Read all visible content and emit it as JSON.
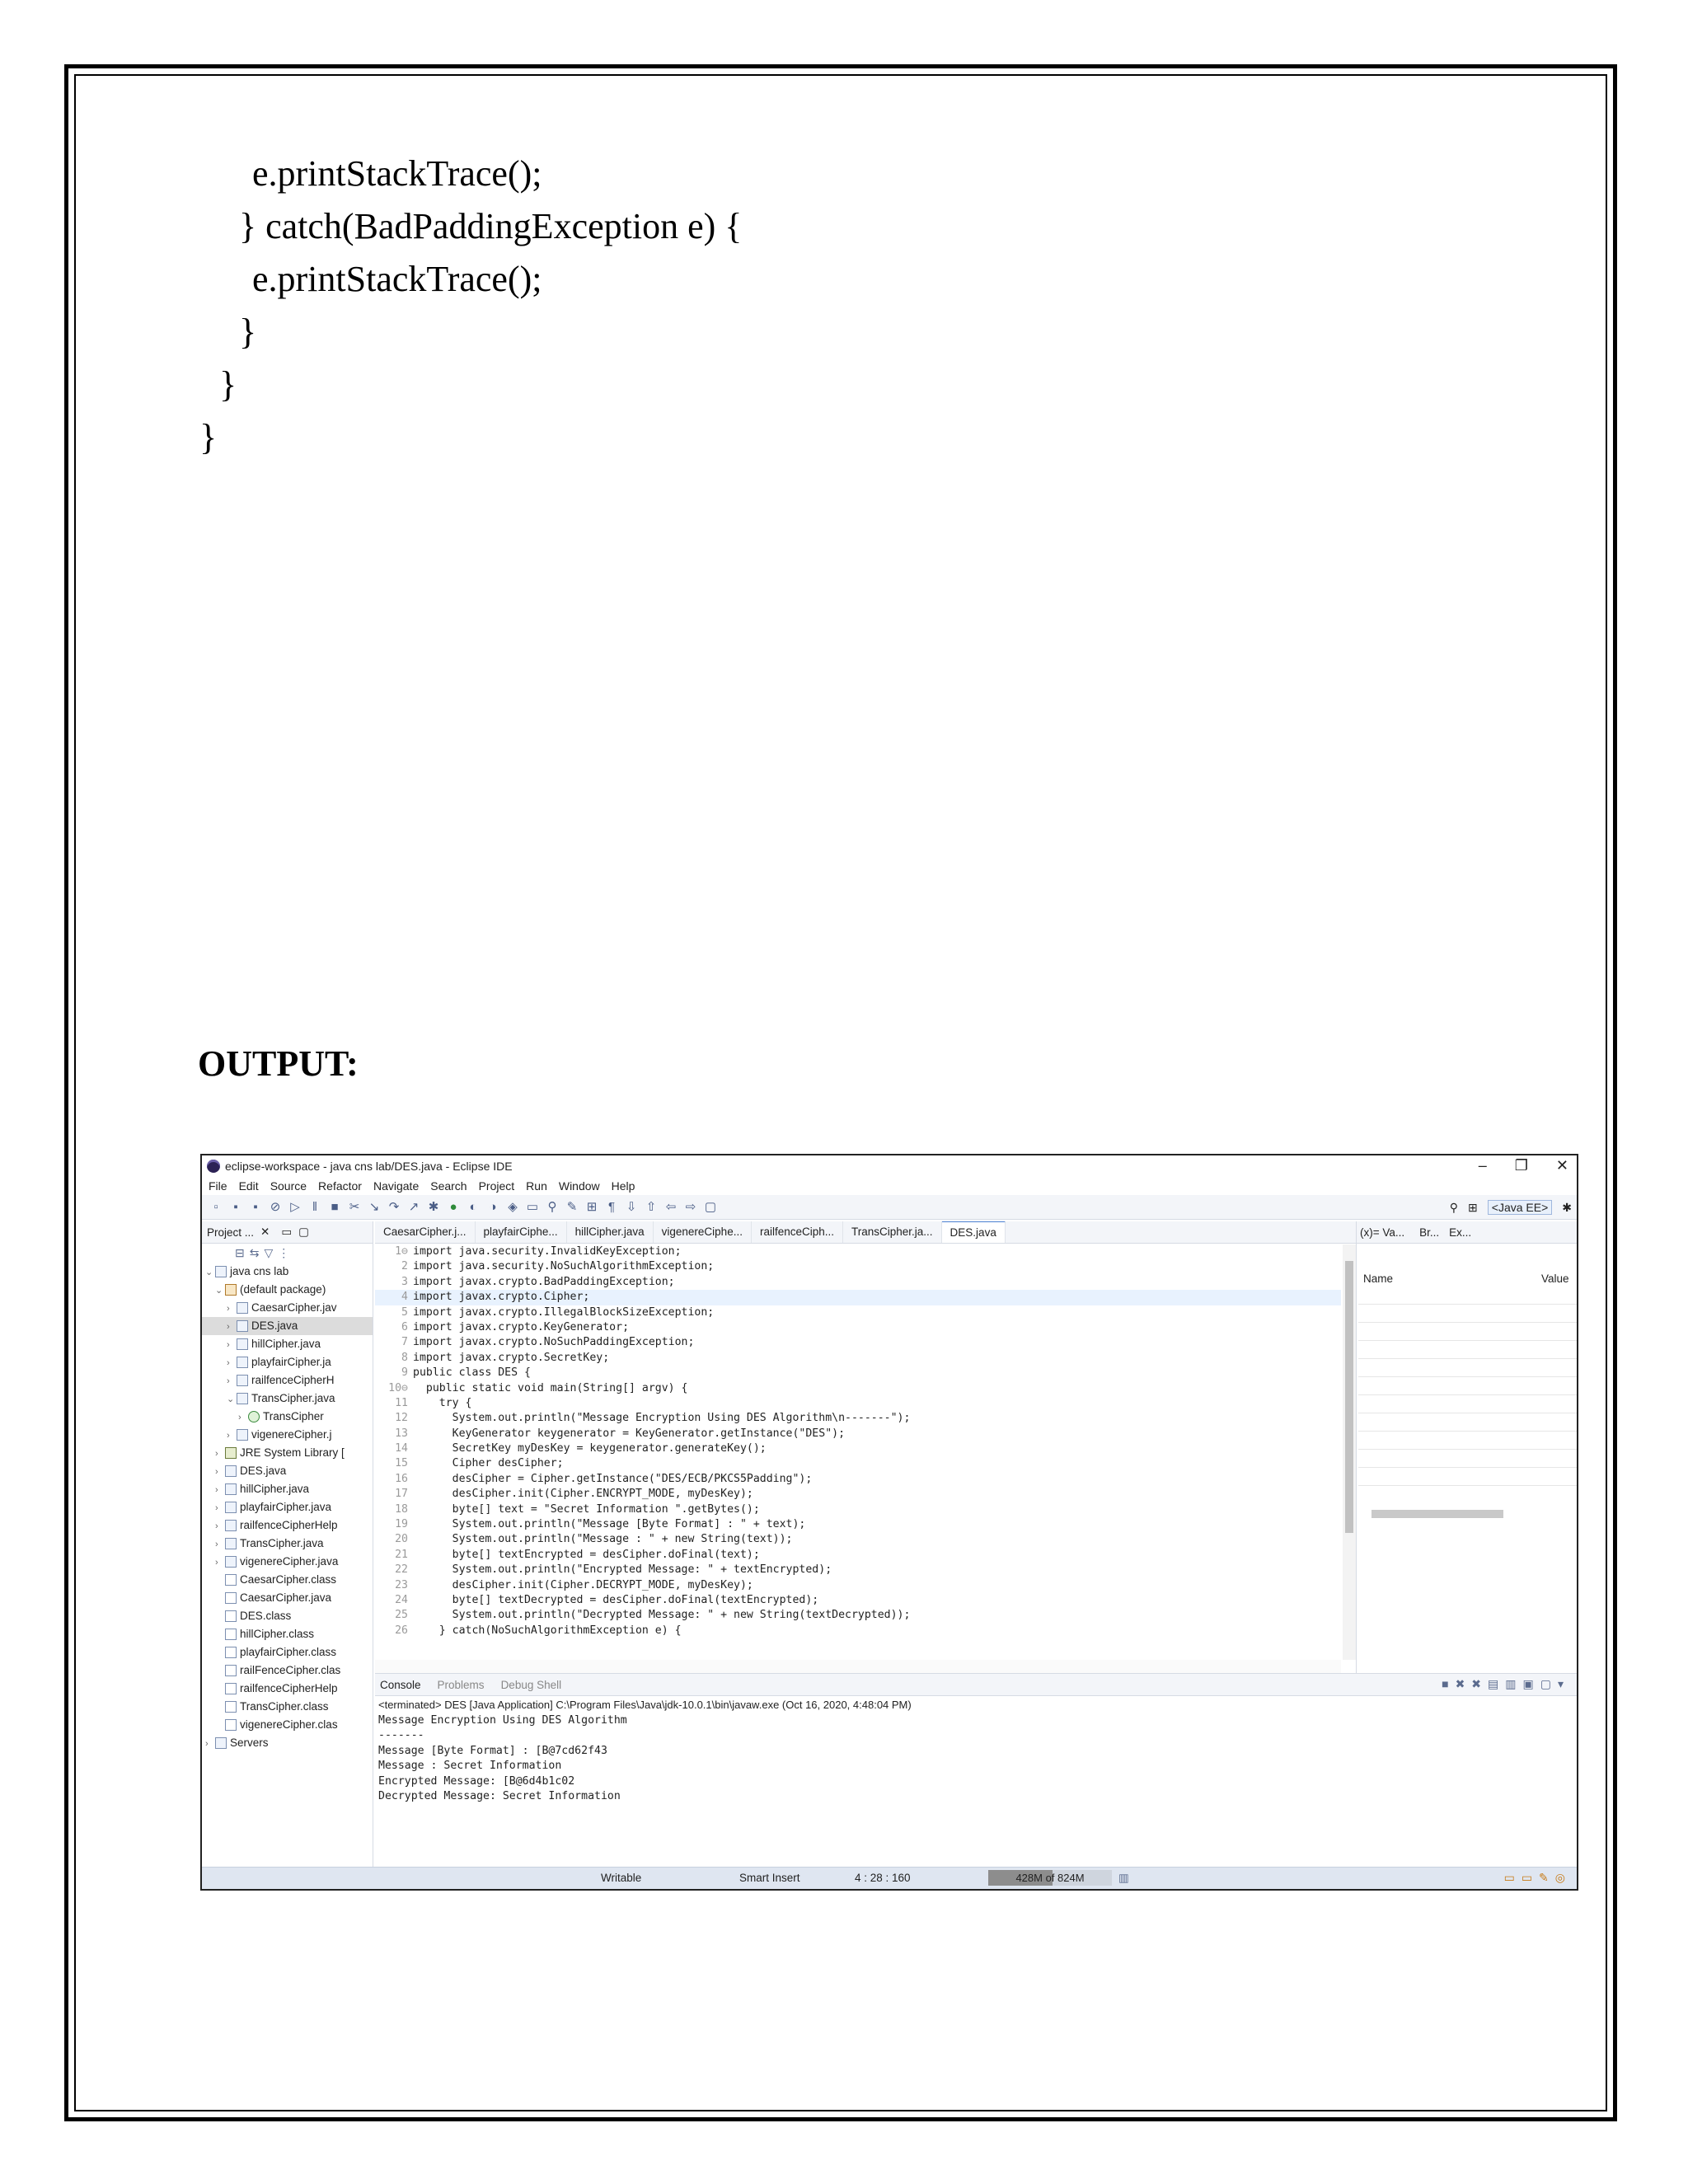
{
  "document": {
    "code_lines": [
      "e.printStackTrace();",
      "} catch(BadPaddingException e) {",
      "e.printStackTrace();",
      "}",
      "}",
      "}"
    ],
    "output_heading": "OUTPUT:"
  },
  "eclipse": {
    "window_title": "eclipse-workspace - java cns lab/DES.java - Eclipse IDE",
    "window_buttons": [
      "–",
      "❐",
      "✕"
    ],
    "menu": [
      "File",
      "Edit",
      "Source",
      "Refactor",
      "Navigate",
      "Search",
      "Project",
      "Run",
      "Window",
      "Help"
    ],
    "perspective": "<Java EE>",
    "explorer": {
      "title": "Project ...",
      "items": [
        "java cns lab",
        "(default package)",
        "CaesarCipher.jav",
        "DES.java",
        "hillCipher.java",
        "playfairCipher.ja",
        "railfenceCipherH",
        "TransCipher.java",
        "TransCipher",
        "vigenereCipher.j",
        "JRE System Library [",
        "DES.java",
        "hillCipher.java",
        "playfairCipher.java",
        "railfenceCipherHelp",
        "TransCipher.java",
        "vigenereCipher.java",
        "CaesarCipher.class",
        "CaesarCipher.java",
        "DES.class",
        "hillCipher.class",
        "playfairCipher.class",
        "railFenceCipher.clas",
        "railfenceCipherHelp",
        "TransCipher.class",
        "vigenereCipher.clas",
        "Servers"
      ]
    },
    "editor_tabs": [
      "CaesarCipher.j...",
      "playfairCiphe...",
      "hillCipher.java",
      "vigenereCiphe...",
      "railfenceCiph...",
      "TransCipher.ja...",
      "DES.java"
    ],
    "code": [
      {
        "n": "1⊖",
        "t": "import java.security.InvalidKeyException;"
      },
      {
        "n": "2",
        "t": "import java.security.NoSuchAlgorithmException;"
      },
      {
        "n": "3",
        "t": "import javax.crypto.BadPaddingException;"
      },
      {
        "n": "4",
        "t": "import javax.crypto.Cipher;"
      },
      {
        "n": "5",
        "t": "import javax.crypto.IllegalBlockSizeException;"
      },
      {
        "n": "6",
        "t": "import javax.crypto.KeyGenerator;"
      },
      {
        "n": "7",
        "t": "import javax.crypto.NoSuchPaddingException;"
      },
      {
        "n": "8",
        "t": "import javax.crypto.SecretKey;"
      },
      {
        "n": "9",
        "t": "public class DES {"
      },
      {
        "n": "10⊖",
        "t": "  public static void main(String[] argv) {"
      },
      {
        "n": "11",
        "t": "    try {"
      },
      {
        "n": "12",
        "t": "      System.out.println(\"Message Encryption Using DES Algorithm\\n-------\");"
      },
      {
        "n": "13",
        "t": "      KeyGenerator keygenerator = KeyGenerator.getInstance(\"DES\");"
      },
      {
        "n": "14",
        "t": "      SecretKey myDesKey = keygenerator.generateKey();"
      },
      {
        "n": "15",
        "t": "      Cipher desCipher;"
      },
      {
        "n": "16",
        "t": "      desCipher = Cipher.getInstance(\"DES/ECB/PKCS5Padding\");"
      },
      {
        "n": "17",
        "t": "      desCipher.init(Cipher.ENCRYPT_MODE, myDesKey);"
      },
      {
        "n": "18",
        "t": "      byte[] text = \"Secret Information \".getBytes();"
      },
      {
        "n": "19",
        "t": "      System.out.println(\"Message [Byte Format] : \" + text);"
      },
      {
        "n": "20",
        "t": "      System.out.println(\"Message : \" + new String(text));"
      },
      {
        "n": "21",
        "t": "      byte[] textEncrypted = desCipher.doFinal(text);"
      },
      {
        "n": "22",
        "t": "      System.out.println(\"Encrypted Message: \" + textEncrypted);"
      },
      {
        "n": "23",
        "t": "      desCipher.init(Cipher.DECRYPT_MODE, myDesKey);"
      },
      {
        "n": "24",
        "t": "      byte[] textDecrypted = desCipher.doFinal(textEncrypted);"
      },
      {
        "n": "25",
        "t": "      System.out.println(\"Decrypted Message: \" + new String(textDecrypted));"
      },
      {
        "n": "26",
        "t": "    } catch(NoSuchAlgorithmException e) {"
      }
    ],
    "vars_tabs": [
      "(x)= Va...",
      "Br...",
      "Ex..."
    ],
    "vars_columns": [
      "Name",
      "Value"
    ],
    "console_tabs": [
      "Console",
      "Problems",
      "Debug Shell"
    ],
    "console_status": "<terminated> DES [Java Application] C:\\Program Files\\Java\\jdk-10.0.1\\bin\\javaw.exe (Oct 16, 2020, 4:48:04 PM)",
    "console_output": [
      "Message Encryption Using DES Algorithm",
      "-------",
      "Message [Byte Format] : [B@7cd62f43",
      "Message : Secret Information",
      "Encrypted Message: [B@6d4b1c02",
      "Decrypted Message: Secret Information"
    ],
    "statusbar": {
      "writable": "Writable",
      "insert_mode": "Smart Insert",
      "position": "4 : 28 : 160",
      "heap": "428M of 824M",
      "heap_used_fraction": 0.52
    }
  }
}
